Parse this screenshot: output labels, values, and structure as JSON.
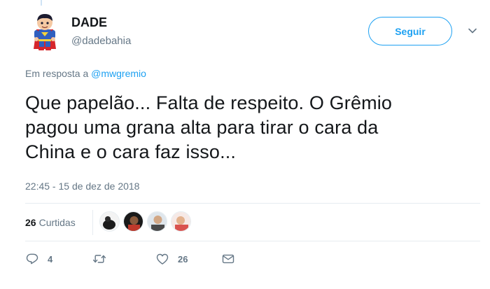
{
  "user": {
    "name": "DADE",
    "handle": "@dadebahia"
  },
  "follow_button_label": "Seguir",
  "reply_to": {
    "prefix": "Em resposta a",
    "mention": "@mwgremio"
  },
  "tweet_text_lines": [
    "Que papelão... Falta de respeito. O Grêmio",
    "pagou uma grana alta para tirar o cara da",
    "China e o cara faz isso..."
  ],
  "timestamp": "22:45 - 15 de dez de 2018",
  "likes": {
    "count": "26",
    "label": "Curtidas"
  },
  "likers": [
    {
      "name": "liker-1"
    },
    {
      "name": "liker-2"
    },
    {
      "name": "liker-3"
    },
    {
      "name": "liker-4"
    }
  ],
  "actions": {
    "reply_count": "4",
    "retweet_count": "",
    "like_count": "26"
  },
  "colors": {
    "accent": "#1da1f2",
    "muted": "#657786",
    "text": "#14171a",
    "divider": "#e6ecf0"
  },
  "icons": {
    "reply": "reply-icon",
    "retweet": "retweet-icon",
    "like": "heart-icon",
    "dm": "envelope-icon",
    "menu": "chevron-down-icon"
  }
}
